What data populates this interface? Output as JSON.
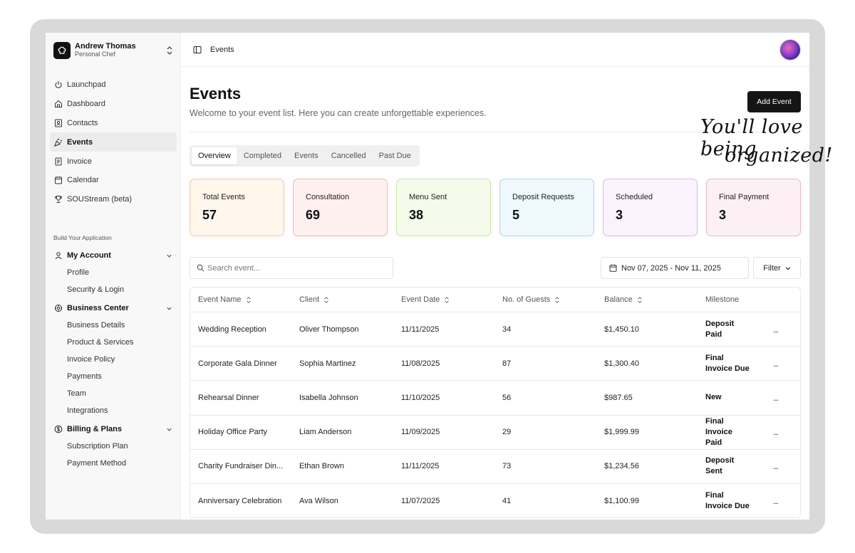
{
  "account": {
    "name": "Andrew Thomas",
    "role": "Personal Chef"
  },
  "nav": [
    {
      "label": "Launchpad",
      "icon": "power-icon"
    },
    {
      "label": "Dashboard",
      "icon": "home-icon"
    },
    {
      "label": "Contacts",
      "icon": "contact-card-icon"
    },
    {
      "label": "Events",
      "icon": "party-icon",
      "active": true
    },
    {
      "label": "Invoice",
      "icon": "invoice-icon"
    },
    {
      "label": "Calendar",
      "icon": "calendar-icon"
    },
    {
      "label": "SOUStream (beta)",
      "icon": "trophy-icon"
    }
  ],
  "build_label": "Build Your Application",
  "groups": [
    {
      "title": "My Account",
      "icon": "user-icon",
      "items": [
        "Profile",
        "Security & Login"
      ]
    },
    {
      "title": "Business Center",
      "icon": "gear-icon",
      "items": [
        "Business Details",
        "Product & Services",
        "Invoice Policy",
        "Payments",
        "Team",
        "Integrations"
      ]
    },
    {
      "title": "Billing & Plans",
      "icon": "dollar-icon",
      "items": [
        "Subscription Plan",
        "Payment Method"
      ]
    }
  ],
  "breadcrumb": "Events",
  "page": {
    "title": "Events",
    "subtitle": "Welcome to your event list. Here you can create unforgettable experiences.",
    "add_button": "Add Event"
  },
  "tabs": [
    "Overview",
    "Completed",
    "Events",
    "Cancelled",
    "Past Due"
  ],
  "stats": [
    {
      "label": "Total Events",
      "value": "57",
      "bg": "#fff6ec",
      "border": "#f5c99a"
    },
    {
      "label": "Consultation",
      "value": "69",
      "bg": "#fff0f0",
      "border": "#f3b6b6"
    },
    {
      "label": "Menu Sent",
      "value": "38",
      "bg": "#f4fbea",
      "border": "#c9e7a3"
    },
    {
      "label": "Deposit Requests",
      "value": "5",
      "bg": "#eef8fd",
      "border": "#a9d8f0"
    },
    {
      "label": "Scheduled",
      "value": "3",
      "bg": "#faf2fd",
      "border": "#dcb9ef"
    },
    {
      "label": "Final Payment",
      "value": "3",
      "bg": "#fdf0f4",
      "border": "#f1b5c8"
    }
  ],
  "search": {
    "placeholder": "Search event..."
  },
  "date_range": "Nov 07, 2025 - Nov 11, 2025",
  "filter_label": "Filter",
  "table": {
    "headers": [
      "Event Name",
      "Client",
      "Event Date",
      "No. of Guests",
      "Balance",
      "Milestone"
    ],
    "rows": [
      [
        "Wedding Reception",
        "Oliver Thompson",
        "11/11/2025",
        "34",
        "$1,450.10",
        "Deposit Paid"
      ],
      [
        "Corporate Gala Dinner",
        "Sophia Martinez",
        "11/08/2025",
        "87",
        "$1,300.40",
        "Final Invoice Due"
      ],
      [
        "Rehearsal Dinner",
        "Isabella Johnson",
        "11/10/2025",
        "56",
        "$987.65",
        "New"
      ],
      [
        "Holiday Office Party",
        "Liam Anderson",
        "11/09/2025",
        "29",
        "$1,999.99",
        "Final Invoice Paid"
      ],
      [
        "Charity Fundraiser Din...",
        "Ethan Brown",
        "11/11/2025",
        "73",
        "$1,234.56",
        "Deposit Sent"
      ],
      [
        "Anniversary Celebration",
        "Ava Wilson",
        "11/07/2025",
        "41",
        "$1,100.99",
        "Final Invoice Due"
      ]
    ],
    "row_action": "..."
  },
  "tagline": {
    "line1": "You'll love being",
    "line2": "organized!"
  }
}
